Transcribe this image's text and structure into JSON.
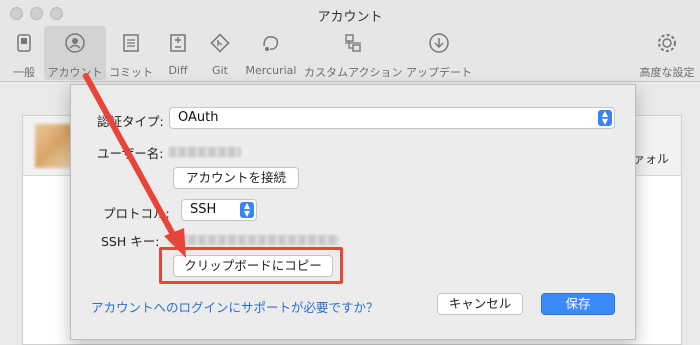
{
  "window": {
    "title": "アカウント"
  },
  "toolbar": {
    "items": [
      {
        "label": "一般",
        "icon": "switch-icon"
      },
      {
        "label": "アカウント",
        "icon": "account-icon"
      },
      {
        "label": "コミット",
        "icon": "document-icon"
      },
      {
        "label": "Diff",
        "icon": "diff-icon"
      },
      {
        "label": "Git",
        "icon": "git-icon"
      },
      {
        "label": "Mercurial",
        "icon": "mercurial-icon"
      },
      {
        "label": "カスタムアクション",
        "icon": "custom-action-icon"
      },
      {
        "label": "アップデート",
        "icon": "update-icon"
      },
      {
        "label": "高度な設定",
        "icon": "gear-icon"
      }
    ],
    "active_index": 1
  },
  "background": {
    "column_text": "ァォル"
  },
  "sheet": {
    "auth_type_label": "認証タイプ:",
    "auth_type_value": "OAuth",
    "username_label": "ユーザー名:",
    "connect_button": "アカウントを接続",
    "protocol_label": "プロトコル:",
    "protocol_value": "SSH",
    "ssh_key_label": "SSH キー:",
    "copy_button": "クリップボードにコピー",
    "help_link": "アカウントへのログインにサポートが必要ですか？",
    "cancel_button": "キャンセル",
    "save_button": "保存"
  },
  "colors": {
    "accent": "#3b8bf6",
    "annotation": "#e8443a",
    "link": "#2a6fd6"
  }
}
